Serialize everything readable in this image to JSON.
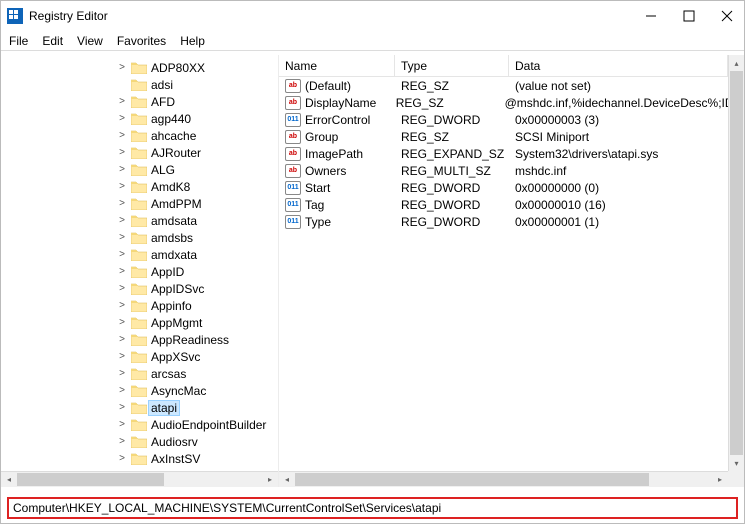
{
  "window": {
    "title": "Registry Editor"
  },
  "menu": {
    "file": "File",
    "edit": "Edit",
    "view": "View",
    "favorites": "Favorites",
    "help": "Help"
  },
  "tree": {
    "items": [
      {
        "name": "ADP80XX",
        "expandable": true
      },
      {
        "name": "adsi",
        "expandable": false
      },
      {
        "name": "AFD",
        "expandable": true
      },
      {
        "name": "agp440",
        "expandable": true
      },
      {
        "name": "ahcache",
        "expandable": true
      },
      {
        "name": "AJRouter",
        "expandable": true
      },
      {
        "name": "ALG",
        "expandable": true
      },
      {
        "name": "AmdK8",
        "expandable": true
      },
      {
        "name": "AmdPPM",
        "expandable": true
      },
      {
        "name": "amdsata",
        "expandable": true
      },
      {
        "name": "amdsbs",
        "expandable": true
      },
      {
        "name": "amdxata",
        "expandable": true
      },
      {
        "name": "AppID",
        "expandable": true
      },
      {
        "name": "AppIDSvc",
        "expandable": true
      },
      {
        "name": "Appinfo",
        "expandable": true
      },
      {
        "name": "AppMgmt",
        "expandable": true
      },
      {
        "name": "AppReadiness",
        "expandable": true
      },
      {
        "name": "AppXSvc",
        "expandable": true
      },
      {
        "name": "arcsas",
        "expandable": true
      },
      {
        "name": "AsyncMac",
        "expandable": true
      },
      {
        "name": "atapi",
        "expandable": true,
        "selected": true
      },
      {
        "name": "AudioEndpointBuilder",
        "expandable": true
      },
      {
        "name": "Audiosrv",
        "expandable": true
      },
      {
        "name": "AxInstSV",
        "expandable": true
      }
    ]
  },
  "list": {
    "columns": {
      "name": "Name",
      "type": "Type",
      "data": "Data"
    },
    "rows": [
      {
        "icon": "ab",
        "name": "(Default)",
        "type": "REG_SZ",
        "data": "(value not set)"
      },
      {
        "icon": "ab",
        "name": "DisplayName",
        "type": "REG_SZ",
        "data": "@mshdc.inf,%idechannel.DeviceDesc%;ID"
      },
      {
        "icon": "011",
        "name": "ErrorControl",
        "type": "REG_DWORD",
        "data": "0x00000003 (3)"
      },
      {
        "icon": "ab",
        "name": "Group",
        "type": "REG_SZ",
        "data": "SCSI Miniport"
      },
      {
        "icon": "ab",
        "name": "ImagePath",
        "type": "REG_EXPAND_SZ",
        "data": "System32\\drivers\\atapi.sys"
      },
      {
        "icon": "ab",
        "name": "Owners",
        "type": "REG_MULTI_SZ",
        "data": "mshdc.inf"
      },
      {
        "icon": "011",
        "name": "Start",
        "type": "REG_DWORD",
        "data": "0x00000000 (0)"
      },
      {
        "icon": "011",
        "name": "Tag",
        "type": "REG_DWORD",
        "data": "0x00000010 (16)"
      },
      {
        "icon": "011",
        "name": "Type",
        "type": "REG_DWORD",
        "data": "0x00000001 (1)"
      }
    ]
  },
  "address": {
    "path": "Computer\\HKEY_LOCAL_MACHINE\\SYSTEM\\CurrentControlSet\\Services\\atapi"
  }
}
